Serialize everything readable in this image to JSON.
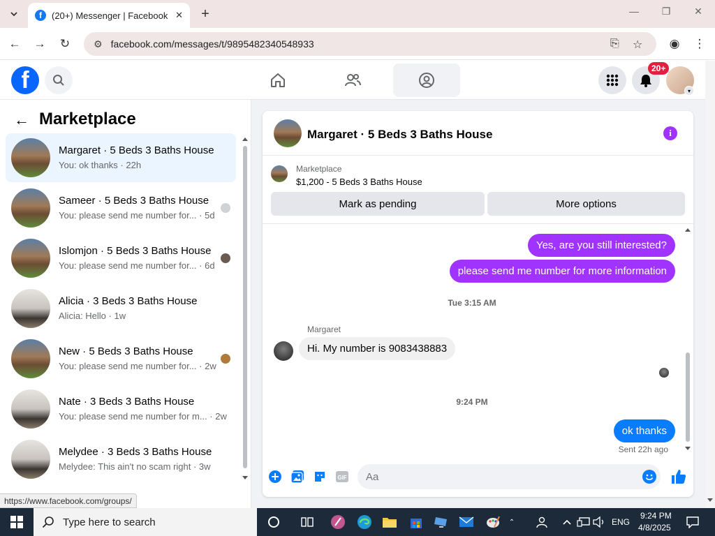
{
  "browser": {
    "tab_title": "(20+) Messenger | Facebook",
    "favicon_letter": "f",
    "url": "facebook.com/messages/t/9895482340548933",
    "status_url": "https://www.facebook.com/groups/"
  },
  "header": {
    "logo_letter": "f",
    "notification_badge": "20+"
  },
  "sidebar": {
    "title": "Marketplace",
    "threads": [
      {
        "name": "Margaret · 5 Beds 3 Baths House",
        "snippet": "You: ok thanks · 22h",
        "thumb": "house",
        "active": true
      },
      {
        "name": "Sameer · 5 Beds 3 Baths House",
        "snippet": "You: please send me number for... · 5d",
        "thumb": "house"
      },
      {
        "name": "Islomjon · 5 Beds 3 Baths House",
        "snippet": "You: please send me number for... · 6d",
        "thumb": "house"
      },
      {
        "name": "Alicia · 3 Beds 3 Baths House",
        "snippet": "Alicia: Hello · 1w",
        "thumb": "room"
      },
      {
        "name": "New · 5 Beds 3 Baths House",
        "snippet": "You: please send me number for... · 2w",
        "thumb": "house"
      },
      {
        "name": "Nate · 3 Beds 3 Baths House",
        "snippet": "You: please send me number for m... · 2w",
        "thumb": "room"
      },
      {
        "name": "Melydee · 3 Beds 3 Baths House",
        "snippet": "Melydee: This ain't no scam right · 3w",
        "thumb": "room"
      }
    ]
  },
  "chat": {
    "title": "Margaret · 5 Beds 3 Baths House",
    "listing_source": "Marketplace",
    "listing_price": "$1,200 - 5 Beds 3 Baths House",
    "mark_pending_label": "Mark as pending",
    "more_options_label": "More options",
    "messages": {
      "out1": "Yes, are you still interested?",
      "out2": "please send me number for more information",
      "ts1": "Tue 3:15 AM",
      "sender": "Margaret",
      "in1": "Hi. My number is 9083438883",
      "ts2": "9:24 PM",
      "out3": "ok thanks",
      "status": "Sent 22h ago"
    },
    "composer_placeholder": "Aa",
    "gif_label": "GIF"
  },
  "taskbar": {
    "search_placeholder": "Type here to search",
    "lang": "ENG",
    "time": "9:24 PM",
    "date": "4/8/2025"
  },
  "colors": {
    "brand": "#0866ff",
    "bubble_purple": "#a033ff",
    "bubble_blue": "#0a7cff"
  }
}
